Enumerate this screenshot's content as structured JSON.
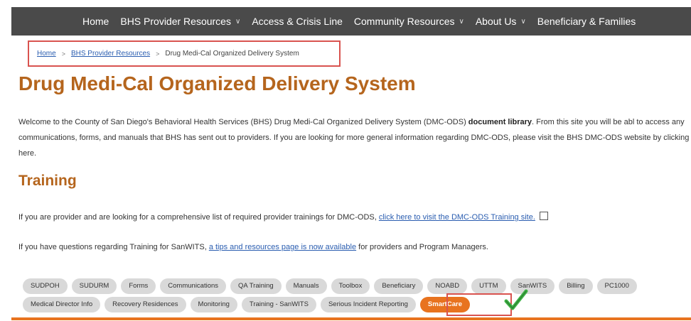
{
  "nav": {
    "items": [
      {
        "label": "Home",
        "dropdown": false
      },
      {
        "label": "BHS Provider Resources",
        "dropdown": true
      },
      {
        "label": "Access & Crisis Line",
        "dropdown": false
      },
      {
        "label": "Community Resources",
        "dropdown": true
      },
      {
        "label": "About Us",
        "dropdown": true
      },
      {
        "label": "Beneficiary & Families",
        "dropdown": false
      }
    ]
  },
  "breadcrumb": {
    "home": "Home",
    "parent": "BHS Provider Resources",
    "current": "Drug Medi-Cal Organized Delivery System",
    "separator": ">"
  },
  "page": {
    "title": "Drug Medi-Cal Organized Delivery System",
    "intro_before": "Welcome to the County of San Diego's Behavioral Health Services (BHS) Drug Medi-Cal Organized Delivery System (DMC-ODS) ",
    "intro_bold": "document library",
    "intro_after": ". From this site you will be abl to access any communications, forms, and manuals that BHS has sent out to providers. If you are looking for more general information regarding DMC-ODS, please visit the BHS DMC-ODS website by clicking here."
  },
  "training": {
    "title": "Training",
    "p1_before": "If you are provider and are looking for a comprehensive list of required provider trainings for DMC-ODS, ",
    "p1_link": "click here to visit the DMC-ODS Training site.",
    "p2_before": "If you have questions regarding Training for SanWITS, ",
    "p2_link": "a tips and resources page is now available",
    "p2_after": " for providers and Program Managers."
  },
  "tabs": {
    "row1": [
      "SUDPOH",
      "SUDURM",
      "Forms",
      "Communications",
      "QA Training",
      "Manuals",
      "Toolbox",
      "Beneficiary",
      "NOABD",
      "UTTM",
      "SanWITS",
      "Billing",
      "PC1000"
    ],
    "row2": [
      "Medical Director Info",
      "Recovery Residences",
      "Monitoring",
      "Training - SanWITS",
      "Serious Incident Reporting",
      "SmartCare"
    ],
    "active": "SmartCare"
  },
  "colors": {
    "nav_bg": "#4a4a4a",
    "title": "#b5651d",
    "accent": "#e8731f",
    "annotation": "#d9534f",
    "check": "#3cb043",
    "link": "#2a5db0"
  }
}
